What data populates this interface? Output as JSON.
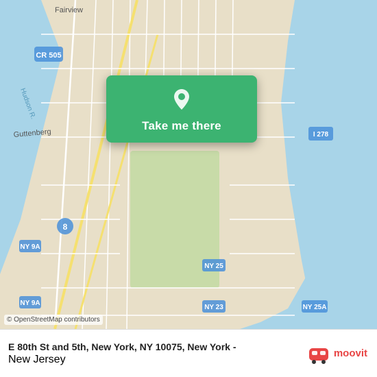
{
  "map": {
    "background_color": "#e8e0d0",
    "osm_attribution": "© OpenStreetMap contributors"
  },
  "card": {
    "button_label": "Take me there",
    "pin_icon": "location-pin"
  },
  "info_bar": {
    "address": "E 80th St and 5th, New York, NY 10075, New York -",
    "address_line2": "New Jersey",
    "moovit_label": "moovit"
  }
}
